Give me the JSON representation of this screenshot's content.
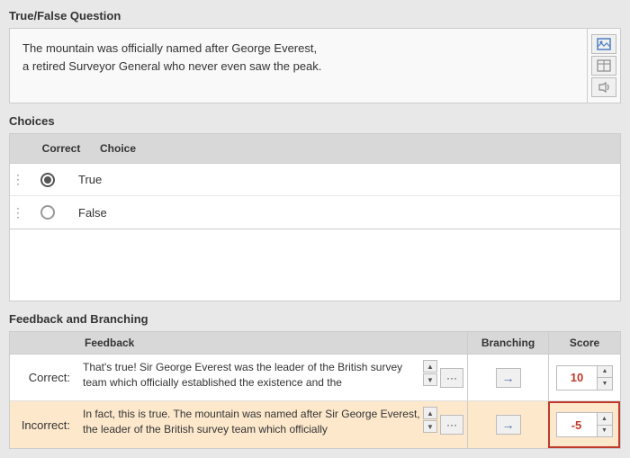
{
  "page": {
    "question_section_title": "True/False Question",
    "question_text_line1": "The mountain was officially named after George Everest,",
    "question_text_line2": "a retired Surveyor General who never even saw the peak.",
    "icons": {
      "image_icon": "🖼",
      "table_icon": "⊞",
      "audio_icon": "🔊"
    },
    "choices_section_title": "Choices",
    "choices_header_correct": "Correct",
    "choices_header_choice": "Choice",
    "choices": [
      {
        "label": "True",
        "correct": true
      },
      {
        "label": "False",
        "correct": false
      }
    ],
    "feedback_section_title": "Feedback and Branching",
    "feedback_header_feedback": "Feedback",
    "feedback_header_branching": "Branching",
    "feedback_header_score": "Score",
    "feedback_rows": [
      {
        "label": "Correct:",
        "text": "That's true! Sir George Everest was the leader of the British survey team which officially established the existence and the",
        "score": "10",
        "is_incorrect": false
      },
      {
        "label": "Incorrect:",
        "text": "In fact, this is true. The mountain was named after Sir George Everest, the leader of the British survey team which officially",
        "score": "-5",
        "is_incorrect": true
      }
    ]
  }
}
